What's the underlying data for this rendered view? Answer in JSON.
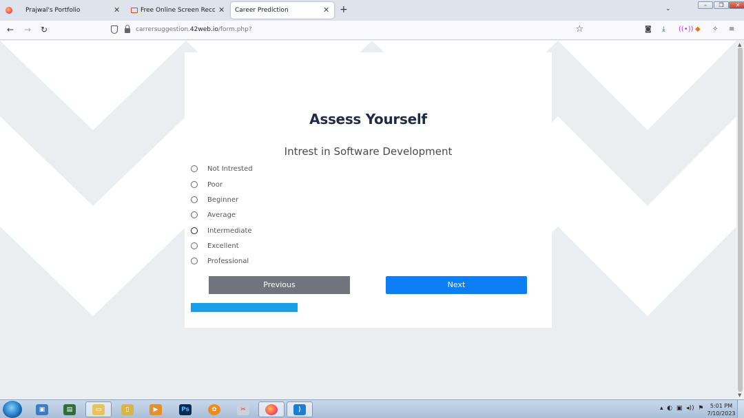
{
  "browser": {
    "tabs": [
      {
        "title": "Prajwal's Portfolio",
        "icon": "firefox-icon",
        "active": false
      },
      {
        "title": "Free Online Screen Recorder &",
        "icon": "screen-recorder-icon",
        "active": false
      },
      {
        "title": "Career Prediction",
        "icon": "",
        "active": true
      }
    ],
    "new_tab_glyph": "+",
    "tab_list_glyph": "⌄",
    "url_prefix": "carrersuggestion.",
    "url_host": "42web.io",
    "url_suffix": "/form.php?"
  },
  "page": {
    "title": "Assess Yourself",
    "question": "Intrest in Software Development",
    "options": [
      "Not Intrested",
      "Poor",
      "Beginner",
      "Average",
      "Intermediate",
      "Excellent",
      "Professional"
    ],
    "hovered_option": "Intermediate",
    "previous_label": "Previous",
    "next_label": "Next",
    "progress_fraction": 0.29,
    "colors": {
      "title": "#1f2a44",
      "next_button": "#0d7ef5",
      "previous_button": "#6f757b",
      "progress": "#1a9fe6",
      "background_pattern": "#ebeef1"
    }
  },
  "taskbar": {
    "apps": [
      "computer-icon",
      "terminal-icon",
      "file-explorer-icon",
      "folder-icon",
      "media-player-icon",
      "photoshop-icon",
      "fl-studio-icon",
      "snipping-tool-icon",
      "firefox-icon",
      "vscode-icon"
    ],
    "photoshop_label": "Ps",
    "clock_time": "5:01 PM",
    "clock_date": "7/10/2023"
  }
}
